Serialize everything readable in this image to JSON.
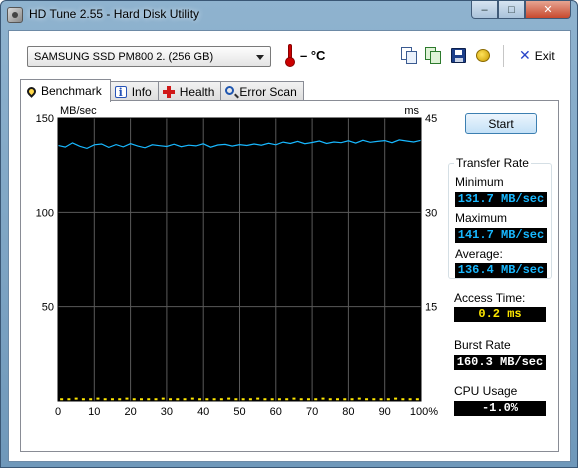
{
  "window": {
    "title": "HD Tune 2.55 - Hard Disk Utility",
    "min_glyph": "–",
    "max_glyph": "□",
    "close_glyph": "✕"
  },
  "toolbar": {
    "drive": "SAMSUNG SSD PM800 2. (256 GB)",
    "temperature": "– °C",
    "exit_icon": "✕",
    "exit_label": "Exit",
    "icons": [
      "copy-text-icon",
      "copy-screenshot-icon",
      "save-icon",
      "options-icon",
      "exit-icon"
    ]
  },
  "tabs": [
    {
      "label": "Benchmark",
      "icon": "benchmark-icon",
      "active": true
    },
    {
      "label": "Info",
      "icon": "info-icon",
      "active": false
    },
    {
      "label": "Health",
      "icon": "health-icon",
      "active": false
    },
    {
      "label": "Error Scan",
      "icon": "error-scan-icon",
      "active": false
    }
  ],
  "benchmark": {
    "start_label": "Start",
    "transfer_rate": {
      "legend": "Transfer Rate",
      "minimum_label": "Minimum",
      "minimum": "131.7 MB/sec",
      "maximum_label": "Maximum",
      "maximum": "141.7 MB/sec",
      "average_label": "Average:",
      "average": "136.4 MB/sec"
    },
    "access_time_label": "Access Time:",
    "access_time": "0.2 ms",
    "burst_rate_label": "Burst Rate",
    "burst_rate": "160.3 MB/sec",
    "cpu_usage_label": "CPU Usage",
    "cpu_usage": "-1.0%"
  },
  "colors": {
    "graph_bg": "#000000",
    "grid": "#5a5a5a",
    "transfer_line": "#18b8ff",
    "access_points": "#ffe800"
  },
  "chart_data": {
    "type": "line",
    "title": "",
    "xlabel": "",
    "ylabel": "MB/sec",
    "y2label": "ms",
    "xlim": [
      0,
      100
    ],
    "ylim": [
      0,
      150
    ],
    "y2lim": [
      0,
      45
    ],
    "x_ticks": [
      "0",
      "10",
      "20",
      "30",
      "40",
      "50",
      "60",
      "70",
      "80",
      "90",
      "100%"
    ],
    "y_ticks": [
      "150",
      "100",
      "50"
    ],
    "y2_ticks": [
      "45",
      "30",
      "15"
    ],
    "grid": true,
    "series": [
      {
        "kind": "transfer_rate",
        "x": [
          0,
          2,
          4,
          6,
          8,
          10,
          12,
          14,
          16,
          18,
          20,
          22,
          24,
          26,
          28,
          30,
          32,
          34,
          36,
          38,
          40,
          42,
          44,
          46,
          48,
          50,
          52,
          54,
          56,
          58,
          60,
          62,
          64,
          66,
          68,
          70,
          72,
          74,
          76,
          78,
          80,
          82,
          84,
          86,
          88,
          90,
          92,
          94,
          96,
          98,
          100
        ],
        "values": [
          135.5,
          134.6,
          136.8,
          135.0,
          133.9,
          135.8,
          136.2,
          134.4,
          135.9,
          134.7,
          136.4,
          135.1,
          134.2,
          135.8,
          135.3,
          134.9,
          136.1,
          134.8,
          135.6,
          135.2,
          136.3,
          134.5,
          135.7,
          136.0,
          135.1,
          135.9,
          135.4,
          136.2,
          135.6,
          136.6,
          135.8,
          137.2,
          136.5,
          137.6,
          136.4,
          137.0,
          137.8,
          136.5,
          137.3,
          136.9,
          137.9,
          136.7,
          138.2,
          137.1,
          137.6,
          138.0,
          136.9,
          138.4,
          137.8,
          137.3,
          138.2
        ]
      },
      {
        "kind": "access_time_ms",
        "x": [
          1,
          3,
          5,
          7,
          9,
          11,
          13,
          15,
          17,
          19,
          21,
          23,
          25,
          27,
          29,
          31,
          33,
          35,
          37,
          39,
          41,
          43,
          45,
          47,
          49,
          51,
          53,
          55,
          57,
          59,
          61,
          63,
          65,
          67,
          69,
          71,
          73,
          75,
          77,
          79,
          81,
          83,
          85,
          87,
          89,
          91,
          93,
          95,
          97,
          99
        ],
        "values": [
          0.2,
          0.2,
          0.3,
          0.2,
          0.2,
          0.3,
          0.2,
          0.2,
          0.2,
          0.3,
          0.2,
          0.2,
          0.2,
          0.2,
          0.3,
          0.2,
          0.2,
          0.2,
          0.3,
          0.2,
          0.2,
          0.2,
          0.2,
          0.3,
          0.2,
          0.2,
          0.2,
          0.3,
          0.2,
          0.2,
          0.2,
          0.2,
          0.3,
          0.2,
          0.2,
          0.2,
          0.3,
          0.2,
          0.2,
          0.2,
          0.2,
          0.3,
          0.2,
          0.2,
          0.2,
          0.2,
          0.3,
          0.2,
          0.2,
          0.2
        ]
      }
    ]
  }
}
